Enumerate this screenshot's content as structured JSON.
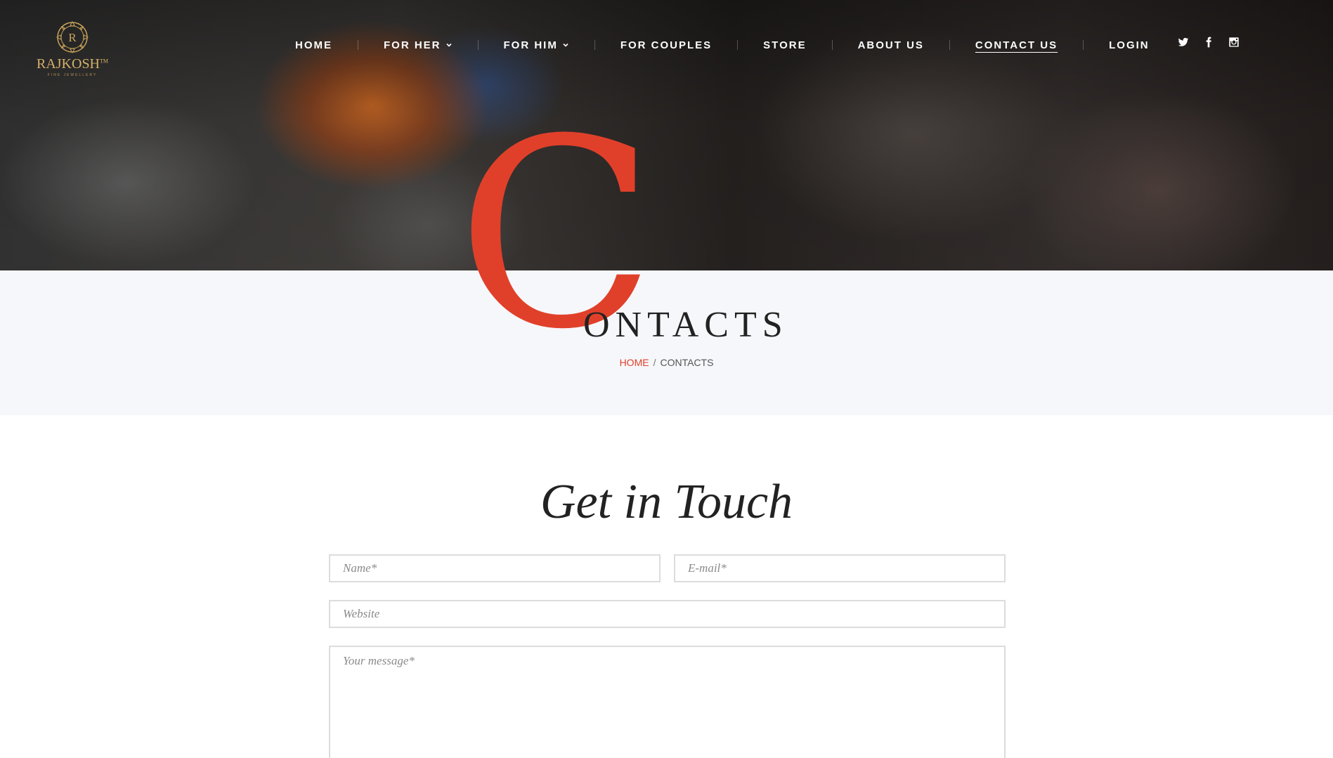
{
  "brand": {
    "name": "RAJKOSH",
    "trademark": "TM",
    "tagline": "FINE JEWELLERY"
  },
  "nav": {
    "items": [
      {
        "label": "HOME",
        "has_dropdown": false,
        "active": false
      },
      {
        "label": "FOR HER",
        "has_dropdown": true,
        "active": false
      },
      {
        "label": "FOR HIM",
        "has_dropdown": true,
        "active": false
      },
      {
        "label": "FOR COUPLES",
        "has_dropdown": false,
        "active": false
      },
      {
        "label": "STORE",
        "has_dropdown": false,
        "active": false
      },
      {
        "label": "ABOUT US",
        "has_dropdown": false,
        "active": false
      },
      {
        "label": "CONTACT US",
        "has_dropdown": false,
        "active": true
      },
      {
        "label": "LOGIN",
        "has_dropdown": false,
        "active": false
      }
    ],
    "social": [
      "twitter-icon",
      "facebook-icon",
      "instagram-icon"
    ]
  },
  "page_header": {
    "drop_cap": "C",
    "title_rest": "ONTACTS",
    "breadcrumb": {
      "home": "HOME",
      "separator": "/",
      "current": "CONTACTS"
    }
  },
  "contact": {
    "heading": "Get in Touch",
    "name_placeholder": "Name*",
    "email_placeholder": "E-mail*",
    "website_placeholder": "Website",
    "message_placeholder": "Your message*"
  },
  "colors": {
    "accent": "#e0402a",
    "text_dark": "#222222",
    "band_bg": "#f6f7fa",
    "logo_gold": "#c9a35a"
  }
}
